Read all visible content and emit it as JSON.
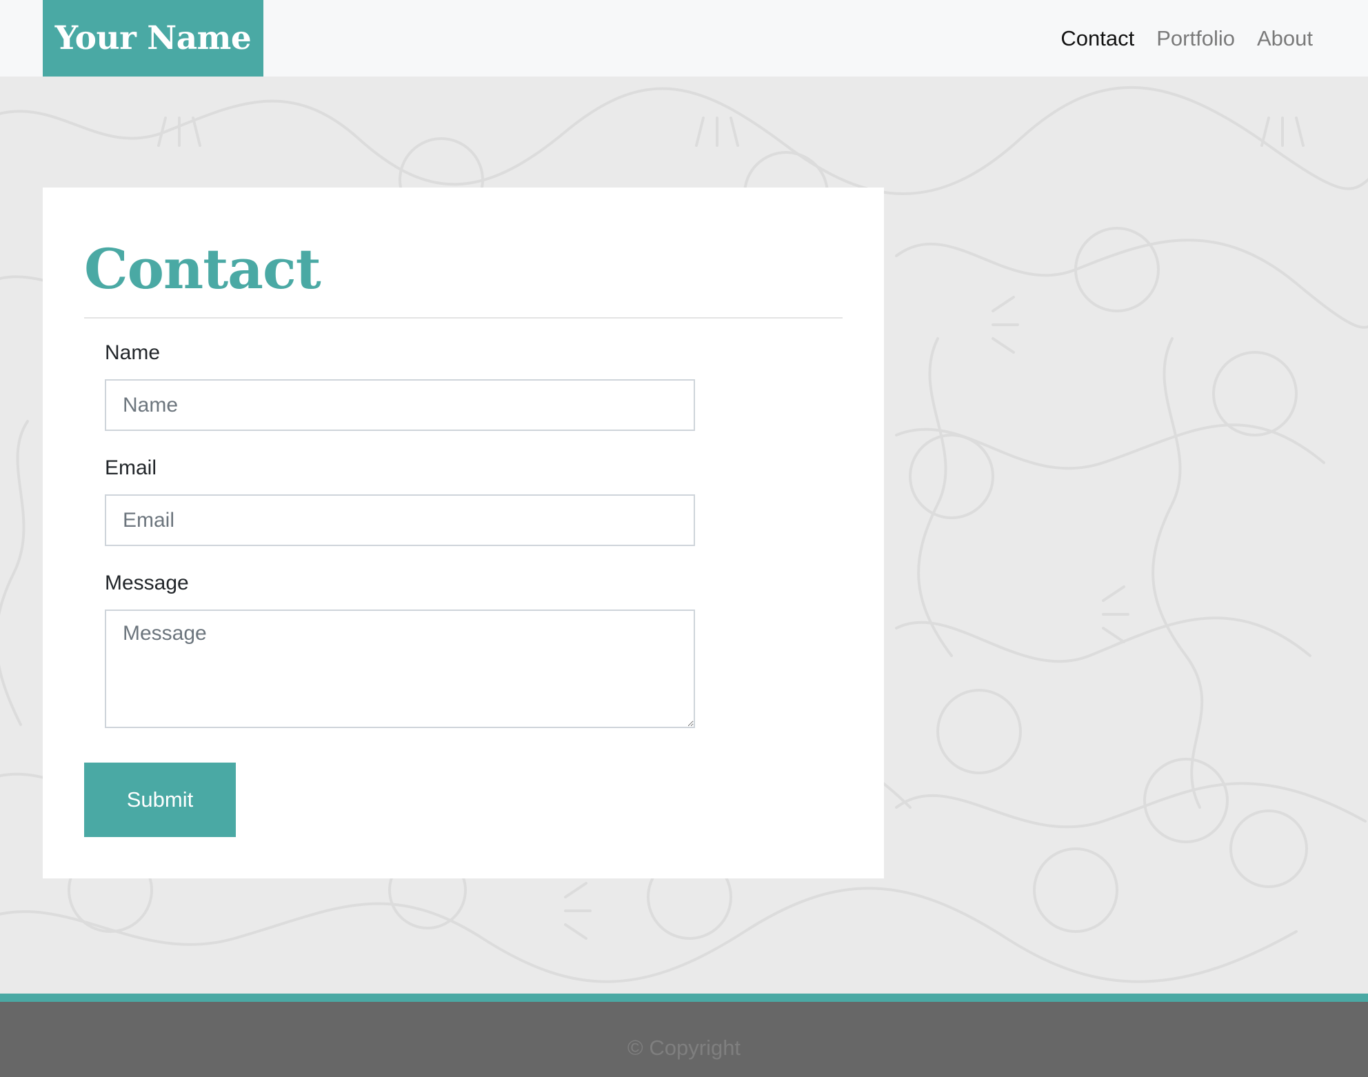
{
  "header": {
    "brand": "Your Name",
    "nav": [
      {
        "label": "Contact",
        "active": true
      },
      {
        "label": "Portfolio",
        "active": false
      },
      {
        "label": "About",
        "active": false
      }
    ]
  },
  "contact": {
    "title": "Contact",
    "fields": {
      "name": {
        "label": "Name",
        "placeholder": "Name",
        "value": ""
      },
      "email": {
        "label": "Email",
        "placeholder": "Email",
        "value": ""
      },
      "message": {
        "label": "Message",
        "placeholder": "Message",
        "value": ""
      }
    },
    "submit_label": "Submit"
  },
  "footer": {
    "copyright": "© Copyright"
  },
  "colors": {
    "accent": "#4aa9a4",
    "navbar_bg": "#f7f8f9",
    "page_bg": "#eaeaea",
    "footer_bg": "#676767",
    "nav_active": "#111111",
    "nav_inactive": "#7a7a7a"
  },
  "icons": {
    "background": "doodle-pattern"
  }
}
